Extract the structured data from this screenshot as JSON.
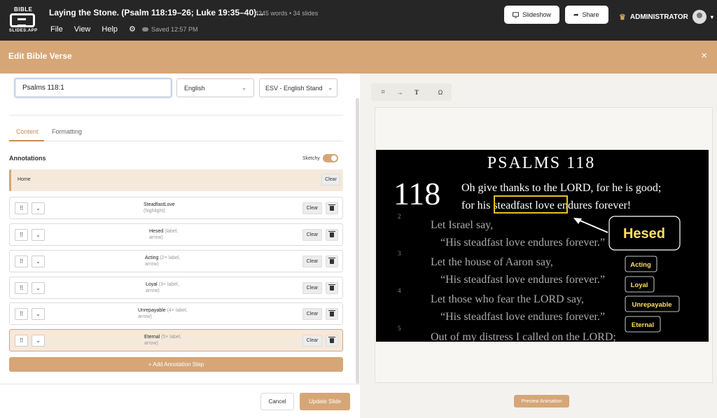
{
  "app": {
    "logo_top": "BIBLE",
    "logo_bottom": "SLIDES.APP",
    "doc_title": "Laying the Stone. (Psalm 118:19–26; Luke 19:35–40)...",
    "doc_meta": "4345 words  •  34 slides",
    "menu": [
      "File",
      "View",
      "Help"
    ],
    "saved": "Saved 12:57 PM",
    "slideshow_label": "Slideshow",
    "share_label": "Share",
    "user_label": "ADMINISTRATOR"
  },
  "modal": {
    "title": "Edit Bible Verse",
    "close": "×"
  },
  "form": {
    "reference": "Psalms 118:1",
    "language": "English",
    "version": "ESV - English Stand"
  },
  "tabs": [
    "Content",
    "Formatting"
  ],
  "annotations": {
    "label": "Annotations",
    "sketchy_label": "Sketchy",
    "home_label": "Home",
    "clear_label": "Clear",
    "steps": [
      {
        "name": "SteadfastLove",
        "detail": "(highlight)"
      },
      {
        "name": "Hesed",
        "detail": "(label, arrow)"
      },
      {
        "name": "Acting",
        "detail": "(2× label, arrow)"
      },
      {
        "name": "Loyal",
        "detail": "(3× label, arrow)"
      },
      {
        "name": "Unrepayable",
        "detail": "(4× label, arrow)"
      },
      {
        "name": "Eternal",
        "detail": "(5× label, arrow)"
      }
    ],
    "add_label": "+  Add Annotation Step"
  },
  "footer": {
    "cancel": "Cancel",
    "update": "Update Slide"
  },
  "preview": {
    "button": "Preview Animation",
    "slide": {
      "title": "PSALMS 118",
      "chapter": "118",
      "verse1_line1": "Oh give thanks to the LORD, for he is good;",
      "verse1_pre": "for his ",
      "verse1_highlight": "steadfast love",
      "verse1_post": " endures forever!",
      "verses": [
        {
          "num": "2",
          "l1": "Let Israel say,",
          "l2": "“His steadfast love endures forever.”"
        },
        {
          "num": "3",
          "l1": "Let the house of Aaron say,",
          "l2": "“His steadfast love endures forever.”"
        },
        {
          "num": "4",
          "l1": "Let those who fear the LORD say,",
          "l2": "“His steadfast love endures forever.”"
        },
        {
          "num": "5",
          "l1": "Out of my distress I called on the LORD;",
          "l2": ""
        }
      ],
      "hesed_label": "Hesed",
      "tags": [
        "Acting",
        "Loyal",
        "Unrepayable",
        "Eternal"
      ]
    }
  },
  "colors": {
    "accent": "#d6a677",
    "highlight": "#e8c020",
    "topbar": "#262626"
  }
}
